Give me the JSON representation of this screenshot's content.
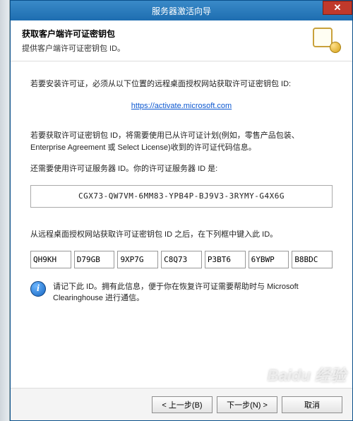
{
  "title": "服务器激活向导",
  "header": {
    "h1": "获取客户端许可证密钥包",
    "h2": "提供客户端许可证密钥包 ID。"
  },
  "body": {
    "p1": "若要安装许可证，必须从以下位置的远程桌面授权网站获取许可证密钥包 ID:",
    "link": "https://activate.microsoft.com",
    "p2": "若要获取许可证密钥包 ID，将需要使用已从许可证计划(例如，零售产品包装、Enterprise Agreement 或 Select License)收到的许可证代码信息。",
    "p3": "还需要使用许可证服务器 ID。你的许可证服务器 ID 是:",
    "server_id": "CGX73-QW7VM-6MM83-YPB4P-BJ9V3-3RYMY-G4X6G",
    "p4": "从远程桌面授权网站获取许可证密钥包 ID 之后，在下列框中键入此 ID。",
    "keypack": [
      "QH9KH",
      "D79GB",
      "9XP7G",
      "C8Q73",
      "P3BT6",
      "6YBWP",
      "B8BDC"
    ],
    "info": "请记下此 ID。拥有此信息，便于你在恢复许可证需要帮助时与 Microsoft Clearinghouse 进行通信。"
  },
  "footer": {
    "back": "< 上一步(B)",
    "next": "下一步(N) >",
    "cancel": "取消"
  },
  "watermark": "Baidu 经验"
}
